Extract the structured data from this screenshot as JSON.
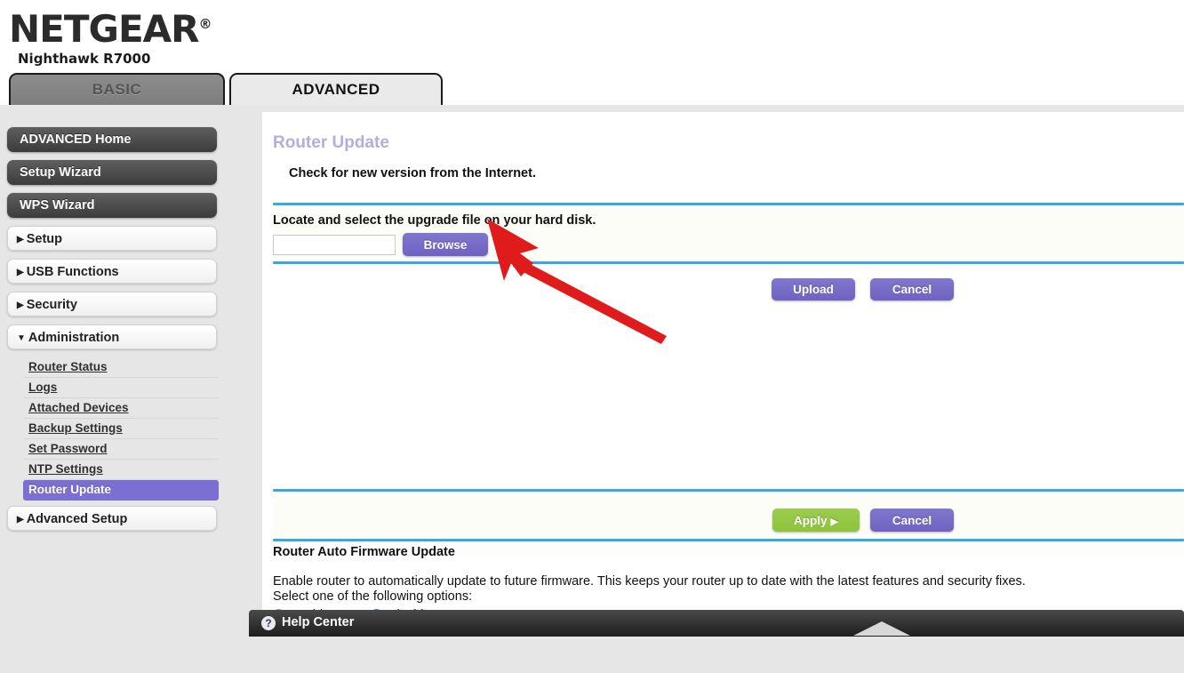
{
  "brand": {
    "logo": "NETGEAR",
    "registered_mark": "®",
    "model": "Nighthawk R7000"
  },
  "tabs": [
    {
      "id": "basic",
      "label": "BASIC",
      "active": false
    },
    {
      "id": "advanced",
      "label": "ADVANCED",
      "active": true
    }
  ],
  "sidebar": {
    "primary": [
      {
        "label": "ADVANCED Home",
        "style": "dark"
      },
      {
        "label": "Setup Wizard",
        "style": "dark"
      },
      {
        "label": "WPS Wizard",
        "style": "dark"
      }
    ],
    "groups": [
      {
        "label": "Setup",
        "caret": "▶",
        "expanded": false
      },
      {
        "label": "USB Functions",
        "caret": "▶",
        "expanded": false
      },
      {
        "label": "Security",
        "caret": "▶",
        "expanded": false
      },
      {
        "label": "Administration",
        "caret": "▼",
        "expanded": true
      }
    ],
    "submenu": [
      {
        "label": "Router Status",
        "active": false
      },
      {
        "label": "Logs",
        "active": false
      },
      {
        "label": "Attached Devices",
        "active": false
      },
      {
        "label": "Backup Settings",
        "active": false
      },
      {
        "label": "Set Password",
        "active": false
      },
      {
        "label": "NTP Settings",
        "active": false
      },
      {
        "label": "Router Update",
        "active": true
      }
    ],
    "trailing_group": {
      "label": "Advanced Setup",
      "caret": "▶",
      "expanded": false
    }
  },
  "content": {
    "page_title": "Router Update",
    "subtitle": "Check for new version from the Internet.",
    "locate_label": "Locate and select the upgrade file on your hard disk.",
    "file_field": {
      "value": "",
      "placeholder": ""
    },
    "browse_button": "Browse",
    "upload_button": "Upload",
    "cancel_button_top": "Cancel",
    "apply_button": "Apply",
    "apply_button_arrow": "▶",
    "cancel_button_bottom": "Cancel",
    "auto_update": {
      "title": "Router Auto Firmware Update",
      "description": "Enable router to automatically update to future firmware. This keeps your router up to date with the latest features and security fixes.",
      "select_line": "Select one of the following options:",
      "options": [
        {
          "label": "Enable",
          "selected": false
        },
        {
          "label": "Disable",
          "selected": true
        }
      ]
    }
  },
  "help_bar": {
    "icon_glyph": "?",
    "label": "Help Center"
  },
  "colors": {
    "accent_purple": "#7b6fd4",
    "divider_blue": "#3aa8dd",
    "apply_green": "#8dc33c",
    "title_purple": "#b3aedd",
    "radio_blue": "#2a7de1",
    "annotation_red": "#e01b1b"
  }
}
